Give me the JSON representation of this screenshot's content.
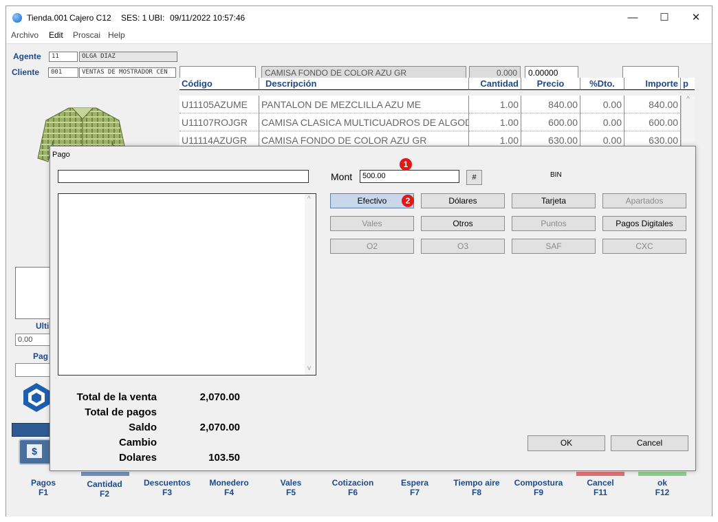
{
  "window": {
    "title": "Tienda.001",
    "cashier": "Cajero C12",
    "session": "SES: 1",
    "location_label": "UBI:",
    "datetime": "09/11/2022 10:57:46",
    "minimize": "—",
    "maximize": "☐",
    "close": "✕"
  },
  "menu": [
    "Archivo",
    "Edit",
    "Proscai",
    "Help"
  ],
  "header": {
    "agent_label": "Agente",
    "agent_code": "11",
    "agent_name": "OLGA DIAZ",
    "client_label": "Cliente",
    "client_code": "001",
    "client_name": "VENTAS DE MOSTRADOR CEN",
    "scan_input": "",
    "item_description": "CAMISA FONDO DE COLOR AZU GR",
    "item_qty": "0.000",
    "item_price": "0.00000",
    "extra_input": ""
  },
  "grid": {
    "columns": [
      "Código",
      "Descripción",
      "Cantidad",
      "Precio",
      "%Dto.",
      "Importe",
      "p"
    ],
    "rows": [
      {
        "code": "U11105AZUME",
        "desc": "PANTALON DE MEZCLILLA AZU ME",
        "qty": "1.00",
        "price": "840.00",
        "disc": "0.00",
        "amount": "840.00"
      },
      {
        "code": "U11107ROJGR",
        "desc": "CAMISA CLASICA MULTICUADROS DE ALGODON RO",
        "qty": "1.00",
        "price": "600.00",
        "disc": "0.00",
        "amount": "600.00"
      },
      {
        "code": "U11114AZUGR",
        "desc": "CAMISA FONDO DE COLOR AZU GR",
        "qty": "1.00",
        "price": "630.00",
        "disc": "0.00",
        "amount": "630.00"
      }
    ]
  },
  "left_panel": {
    "ulti_label": "Ulti",
    "value": "0.00",
    "pag_label": "Pag",
    "dollar_sign": "$"
  },
  "toolbar": [
    {
      "label": "Pagos",
      "key": "F1"
    },
    {
      "label": "Cantidad",
      "key": "F2"
    },
    {
      "label": "Descuentos",
      "key": "F3"
    },
    {
      "label": "Monedero",
      "key": "F4"
    },
    {
      "label": "Vales",
      "key": "F5"
    },
    {
      "label": "Cotizacion",
      "key": "F6"
    },
    {
      "label": "Espera",
      "key": "F7"
    },
    {
      "label": "Tiempo aire",
      "key": "F8"
    },
    {
      "label": "Compostura",
      "key": "F9"
    },
    {
      "label": "Cancel",
      "key": "F11"
    },
    {
      "label": "ok",
      "key": "F12"
    }
  ],
  "pago": {
    "title": "Pago",
    "top_input": "",
    "mont_label": "Mont",
    "mont_value": "500.00",
    "hash_button": "#",
    "bin_label": "BIN",
    "payment_buttons": [
      {
        "label": "Efectivo",
        "enabled": true,
        "selected": true
      },
      {
        "label": "Dólares",
        "enabled": true
      },
      {
        "label": "Tarjeta",
        "enabled": true
      },
      {
        "label": "Apartados",
        "enabled": false
      },
      {
        "label": "Vales",
        "enabled": false
      },
      {
        "label": "Otros",
        "enabled": true
      },
      {
        "label": "Puntos",
        "enabled": false
      },
      {
        "label": "Pagos Digitales",
        "enabled": true
      },
      {
        "label": "O2",
        "enabled": false
      },
      {
        "label": "O3",
        "enabled": false
      },
      {
        "label": "SAF",
        "enabled": false
      },
      {
        "label": "CXC",
        "enabled": false
      }
    ],
    "totals": {
      "total_venta_label": "Total de la venta",
      "total_venta": "2,070.00",
      "total_pagos_label": "Total de pagos",
      "total_pagos": "",
      "saldo_label": "Saldo",
      "saldo": "2,070.00",
      "cambio_label": "Cambio",
      "cambio": "",
      "dolares_label": "Dolares",
      "dolares": "103.50"
    },
    "ok_button": "OK",
    "cancel_button": "Cancel",
    "badges": [
      "1",
      "2"
    ]
  },
  "colors": {
    "label_blue": "#1c4a8a",
    "badge_red": "#e01818",
    "dialog_bg": "#f0f0f0"
  }
}
